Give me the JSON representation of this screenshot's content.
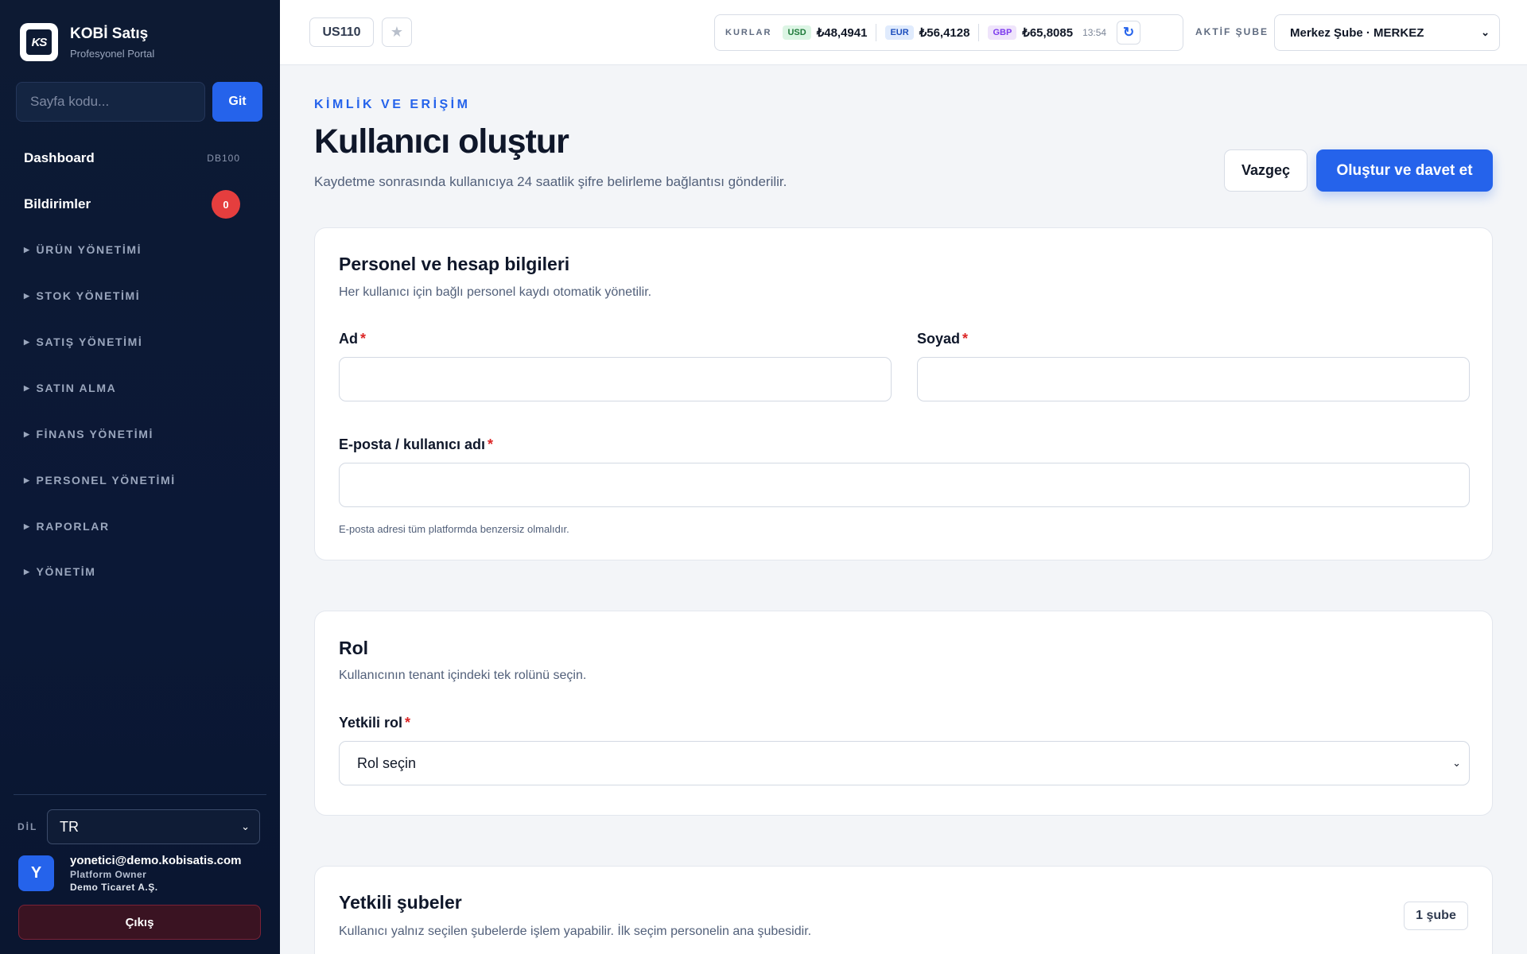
{
  "brand": {
    "name": "KOBİ Satış",
    "subtitle": "Profesyonel Portal",
    "logo_text": "KS"
  },
  "page_jump": {
    "placeholder": "Sayfa kodu...",
    "button_label": "Git"
  },
  "nav": {
    "dashboard": {
      "label": "Dashboard",
      "code": "DB100"
    },
    "notifications": {
      "label": "Bildirimler",
      "count": "0"
    },
    "groups": [
      "ÜRÜN YÖNETİMİ",
      "STOK YÖNETİMİ",
      "SATIŞ YÖNETİMİ",
      "SATIN ALMA",
      "FİNANS YÖNETİMİ",
      "PERSONEL YÖNETİMİ",
      "RAPORLAR",
      "YÖNETİM"
    ]
  },
  "language": {
    "label": "DİL",
    "value": "TR"
  },
  "user": {
    "avatar_letter": "Y",
    "email": "yonetici@demo.kobisatis.com",
    "role": "Platform Owner",
    "company": "Demo Ticaret A.Ş.",
    "logout_label": "Çıkış"
  },
  "topbar": {
    "page_code": "US110",
    "star_icon": "star-icon",
    "rates": {
      "label": "KURLAR",
      "usd": {
        "tag": "USD",
        "value": "₺48,4941"
      },
      "eur": {
        "tag": "EUR",
        "value": "₺56,4128"
      },
      "gbp": {
        "tag": "GBP",
        "value": "₺65,8085"
      },
      "time": "13:54"
    },
    "branch": {
      "label": "AKTİF ŞUBE",
      "value": "Merkez Şube · MERKEZ"
    }
  },
  "header": {
    "eyebrow": "KİMLİK VE ERİŞİM",
    "title": "Kullanıcı oluştur",
    "description": "Kaydetme sonrasında kullanıcıya 24 saatlik şifre belirleme bağlantısı gönderilir.",
    "cancel_label": "Vazgeç",
    "submit_label": "Oluştur ve davet et"
  },
  "personal_card": {
    "title": "Personel ve hesap bilgileri",
    "description": "Her kullanıcı için bağlı personel kaydı otomatik yönetilir.",
    "first_name_label": "Ad",
    "first_name_value": "",
    "last_name_label": "Soyad",
    "last_name_value": "",
    "email_label": "E-posta / kullanıcı adı",
    "email_value": "",
    "email_hint": "E-posta adresi tüm platformda benzersiz olmalıdır.",
    "required_mark": "*"
  },
  "role_card": {
    "title": "Rol",
    "description": "Kullanıcının tenant içindeki tek rolünü seçin.",
    "role_label": "Yetkili rol",
    "role_value": "Rol seçin"
  },
  "branches_card": {
    "title": "Yetkili şubeler",
    "description": "Kullanıcı yalnız seçilen şubelerde işlem yapabilir. İlk seçim personelin ana şubesidir.",
    "count": "1 şube"
  },
  "colors": {
    "accent": "#2563eb",
    "sidebar_bg": "#0d1a33",
    "danger": "#e53e3e",
    "required": "#dc2626"
  }
}
